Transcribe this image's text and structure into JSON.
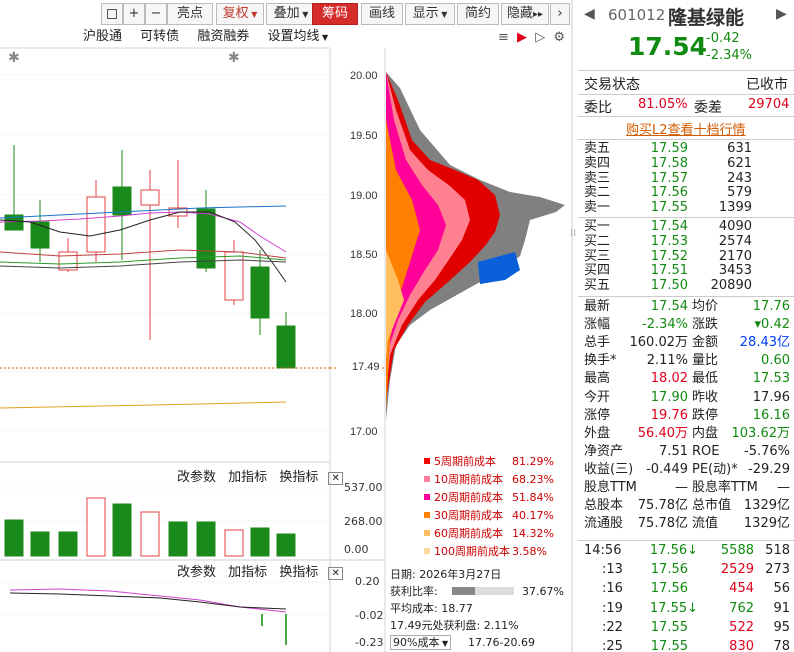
{
  "toolbar": {
    "buttons": [
      "亮点",
      "复权",
      "叠加",
      "筹码",
      "画线",
      "显示",
      "简约",
      "隐藏"
    ],
    "icon_buttons": [
      "restore-icon",
      "plus-icon",
      "minus-icon"
    ],
    "nav_arrows": "▸▸"
  },
  "chart_toolbar": {
    "items": [
      "沪股通",
      "可转债",
      "融资融券",
      "设置均线"
    ]
  },
  "price_axis": {
    "labels": [
      "20.00",
      "19.50",
      "19.00",
      "18.50",
      "18.00",
      "17.49",
      "17.00"
    ]
  },
  "chip_legend": {
    "items": [
      {
        "label": "5周期前成本",
        "value": "81.29%",
        "color": "#ff0000"
      },
      {
        "label": "10周期前成本",
        "value": "68.23%",
        "color": "#ff7f9f"
      },
      {
        "label": "20周期前成本",
        "value": "51.84%",
        "color": "#ff0099"
      },
      {
        "label": "30周期前成本",
        "value": "40.17%",
        "color": "#ff7f00"
      },
      {
        "label": "60周期前成本",
        "value": "14.32%",
        "color": "#ffbf60"
      },
      {
        "label": "100周期前成本",
        "value": "3.58%",
        "color": "#ffd8a0"
      }
    ]
  },
  "volume_panel": {
    "actions": [
      "改参数",
      "加指标",
      "换指标"
    ],
    "axis": [
      "537.00",
      "268.00",
      "0.00"
    ]
  },
  "macd_panel": {
    "actions": [
      "改参数",
      "加指标",
      "换指标"
    ],
    "axis": [
      "0.20",
      "-0.02",
      "-0.23"
    ]
  },
  "chip_info": {
    "date_label": "日期: 2026年3月27日",
    "profit_label": "获利比率:",
    "profit_value": "37.67%",
    "profit_ratio": 0.3767,
    "avg_cost": "平均成本: 18.77",
    "profit_at": "17.49元处获利盘: 2.11%",
    "cost_select": "90%成本",
    "cost_range": "17.76-20.69"
  },
  "quote": {
    "code": "601012",
    "name": "隆基绿能",
    "price": "17.54",
    "change": "-0.42",
    "change_pct": "-2.34%",
    "status_label": "交易状态",
    "status_value": "已收市",
    "weibi_label": "委比",
    "weibi_value": "81.05%",
    "weicha_label": "委差",
    "weicha_value": "29704",
    "l2_link": "购买L2查看十档行情",
    "asks": [
      {
        "label": "卖五",
        "price": "17.59",
        "vol": "631"
      },
      {
        "label": "卖四",
        "price": "17.58",
        "vol": "621"
      },
      {
        "label": "卖三",
        "price": "17.57",
        "vol": "243"
      },
      {
        "label": "卖二",
        "price": "17.56",
        "vol": "579"
      },
      {
        "label": "卖一",
        "price": "17.55",
        "vol": "1399"
      }
    ],
    "bids": [
      {
        "label": "买一",
        "price": "17.54",
        "vol": "4090"
      },
      {
        "label": "买二",
        "price": "17.53",
        "vol": "2574"
      },
      {
        "label": "买三",
        "price": "17.52",
        "vol": "2170"
      },
      {
        "label": "买四",
        "price": "17.51",
        "vol": "3453"
      },
      {
        "label": "买五",
        "price": "17.50",
        "vol": "20890"
      }
    ],
    "stats": [
      {
        "l1": "最新",
        "v1": "17.54",
        "c1": "g",
        "l2": "均价",
        "v2": "17.76",
        "c2": "g"
      },
      {
        "l1": "涨幅",
        "v1": "-2.34%",
        "c1": "g",
        "l2": "涨跌",
        "v2": "▾0.42",
        "c2": "g"
      },
      {
        "l1": "总手",
        "v1": "160.02万",
        "c1": "d",
        "l2": "金额",
        "v2": "28.43亿",
        "c2": "b"
      },
      {
        "l1": "换手*",
        "v1": "2.11%",
        "c1": "d",
        "l2": "量比",
        "v2": "0.60",
        "c2": "g"
      },
      {
        "l1": "最高",
        "v1": "18.02",
        "c1": "r",
        "l2": "最低",
        "v2": "17.53",
        "c2": "g"
      },
      {
        "l1": "今开",
        "v1": "17.90",
        "c1": "g",
        "l2": "昨收",
        "v2": "17.96",
        "c2": "d"
      },
      {
        "l1": "涨停",
        "v1": "19.76",
        "c1": "r",
        "l2": "跌停",
        "v2": "16.16",
        "c2": "g"
      },
      {
        "l1": "外盘",
        "v1": "56.40万",
        "c1": "r",
        "l2": "内盘",
        "v2": "103.62万",
        "c2": "g"
      },
      {
        "l1": "净资产",
        "v1": "7.51",
        "c1": "d",
        "l2": "ROE",
        "v2": "-5.76%",
        "c2": "d"
      },
      {
        "l1": "收益(三)",
        "v1": "-0.449",
        "c1": "d",
        "l2": "PE(动)*",
        "v2": "-29.29",
        "c2": "d"
      },
      {
        "l1": "股息TTM",
        "v1": "—",
        "c1": "d",
        "l2": "股息率TTM",
        "v2": "—",
        "c2": "d"
      },
      {
        "l1": "总股本",
        "v1": "75.78亿",
        "c1": "d",
        "l2": "总市值",
        "v2": "1329亿",
        "c2": "d"
      },
      {
        "l1": "流通股",
        "v1": "75.78亿",
        "c1": "d",
        "l2": "流值",
        "v2": "1329亿",
        "c2": "d"
      }
    ],
    "ticks": [
      {
        "time": "14:56",
        "price": "17.56",
        "arrow": "↓",
        "vol": "5588",
        "n": "518",
        "vc": "g"
      },
      {
        "time": ":13",
        "price": "17.56",
        "arrow": "",
        "vol": "2529",
        "n": "273",
        "vc": "r"
      },
      {
        "time": ":16",
        "price": "17.56",
        "arrow": "",
        "vol": "454",
        "n": "56",
        "vc": "r"
      },
      {
        "time": ":19",
        "price": "17.55",
        "arrow": "↓",
        "vol": "762",
        "n": "91",
        "vc": "g"
      },
      {
        "time": ":22",
        "price": "17.55",
        "arrow": "",
        "vol": "522",
        "n": "95",
        "vc": "r"
      },
      {
        "time": ":25",
        "price": "17.55",
        "arrow": "",
        "vol": "830",
        "n": "78",
        "vc": "r"
      }
    ]
  }
}
